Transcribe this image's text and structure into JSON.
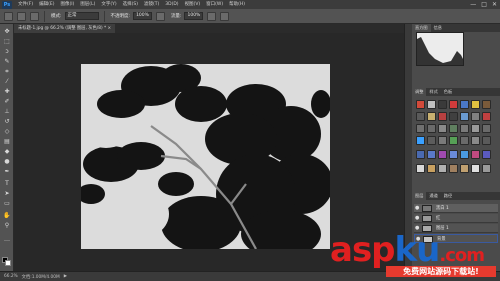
{
  "app": {
    "logo": "Ps"
  },
  "menu": [
    "文件(F)",
    "编辑(E)",
    "图像(I)",
    "图层(L)",
    "文字(Y)",
    "选择(S)",
    "滤镜(T)",
    "3D(D)",
    "视图(V)",
    "窗口(W)",
    "帮助(H)"
  ],
  "window_controls": {
    "minimize": "—",
    "maximize": "□",
    "close": "✕"
  },
  "options": {
    "mode_label": "模式:",
    "mode_value": "正常",
    "opacity_label": "不透明度:",
    "opacity_value": "100%",
    "flow_label": "流量:",
    "flow_value": "100%"
  },
  "document": {
    "tab_label": "未标题-1.jpg @ 66.2% (调整 图层, 灰色/8) * ×",
    "close": "×"
  },
  "statusbar": {
    "zoom": "66.2%",
    "doc": "文档:1.00M/4.00M",
    "arrow": "▶"
  },
  "panels": {
    "top_tabs": [
      "直方图",
      "信息"
    ],
    "adj_tabs": [
      "调整",
      "样式",
      "色板"
    ],
    "layer_tabs": [
      "图层",
      "通道",
      "路径"
    ]
  },
  "layers": [
    {
      "name": "黑白 1",
      "visible": true
    },
    {
      "name": "红",
      "visible": true
    },
    {
      "name": "图层 1",
      "visible": true
    },
    {
      "name": "背景",
      "visible": true
    }
  ],
  "tools": [
    "move-tool",
    "marquee-tool",
    "lasso-tool",
    "quick-select-tool",
    "crop-tool",
    "eyedropper-tool",
    "healing-tool",
    "brush-tool",
    "stamp-tool",
    "history-brush-tool",
    "eraser-tool",
    "gradient-tool",
    "blur-tool",
    "dodge-tool",
    "pen-tool",
    "type-tool",
    "path-select-tool",
    "shape-tool",
    "hand-tool",
    "zoom-tool"
  ],
  "colors": {
    "accent": "#3aa0ff",
    "watermark_red": "#e02020",
    "watermark_blue": "#1a66c8"
  },
  "watermark": {
    "logo_part1": "asp",
    "logo_part2": "ku",
    "logo_part3": ".com",
    "subtitle": "免费网站源码下载站!"
  }
}
